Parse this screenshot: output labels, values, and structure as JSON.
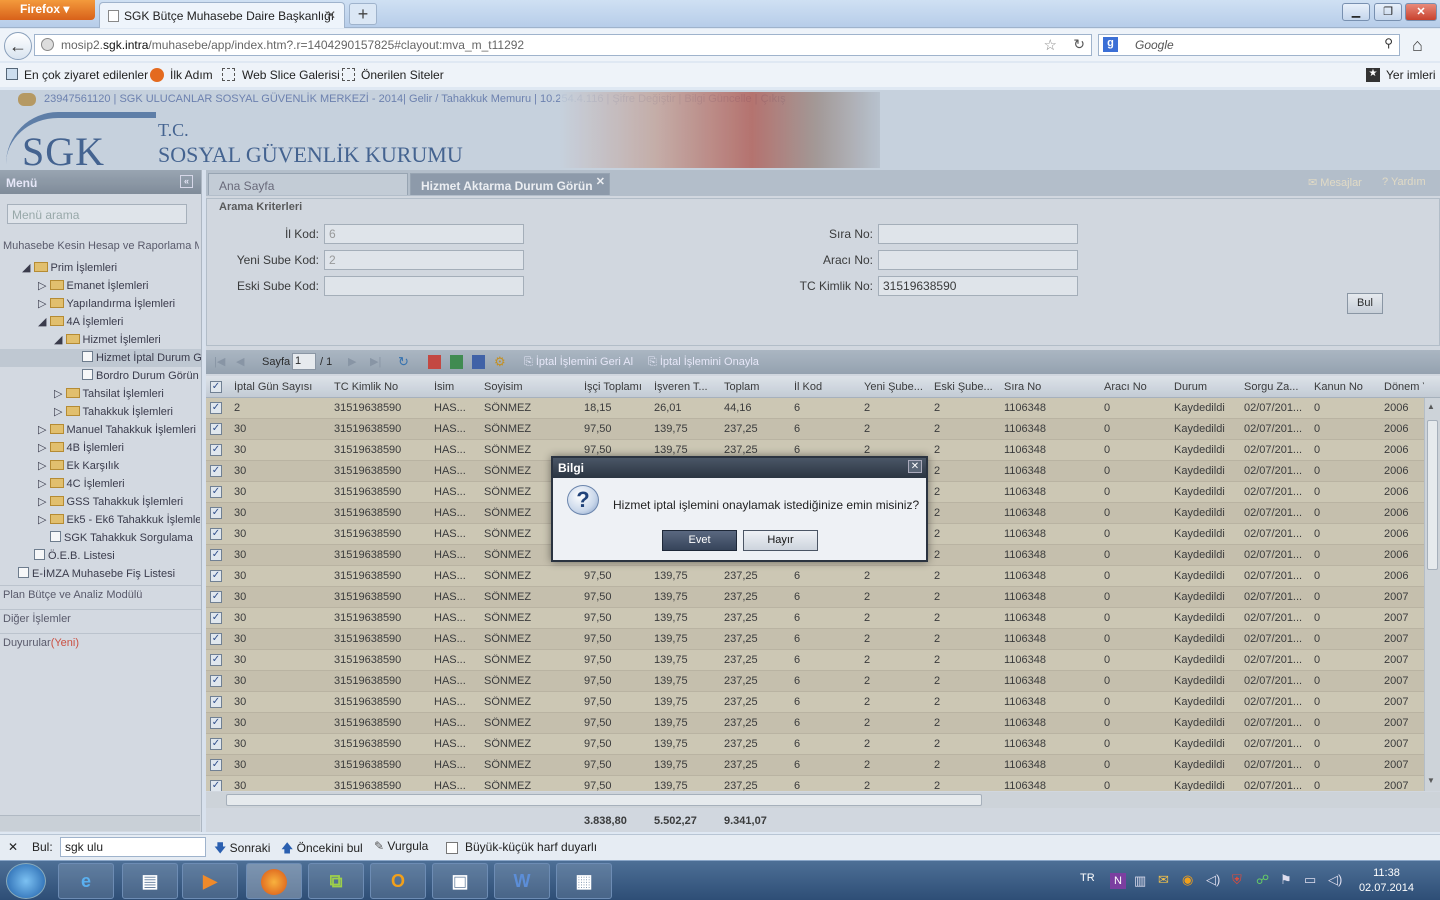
{
  "browser": {
    "app_button": "Firefox",
    "tab_title": "SGK Bütçe Muhasebe Daire Başkanlığı",
    "url_prefix": "mosip2.",
    "url_host": "sgk.intra",
    "url_rest": "/muhasebe/app/index.htm?.r=1404290157825#clayout:mva_m_t11292",
    "search_placeholder": "Google",
    "bookmarks": [
      "En çok ziyaret edilenler",
      "İlk Adım",
      "Web Slice Galerisi",
      "Önerilen Siteler"
    ],
    "bookmarks_right": "Yer imleri"
  },
  "app": {
    "status_line": "23947561120 | SGK ULUCANLAR SOSYAL GÜVENLİK MERKEZİ - 2014| Gelir / Tahakkuk Memuru | 10.254.4.116 | Şifre Değiştir | Bilgi Güncelle | Çıkış",
    "logo_text": "SGK",
    "org_line1": "T.C.",
    "org_line2": "SOSYAL GÜVENLİK KURUMU"
  },
  "sidebar": {
    "title": "Menü",
    "search_placeholder": "Menü arama",
    "section": "Muhasebe Kesin Hesap ve Raporlama Mo",
    "items": [
      "Prim İşlemleri",
      "Emanet İşlemleri",
      "Yapılandırma İşlemleri",
      "4A İşlemleri",
      "Hizmet İşlemleri",
      "Hizmet İptal Durum G",
      "Bordro Durum Görün",
      "Tahsilat İşlemleri",
      "Tahakkuk İşlemleri",
      "Manuel Tahakkuk İşlemleri",
      "4B İşlemleri",
      "Ek Karşılık",
      "4C İşlemleri",
      "GSS Tahakkuk İşlemleri",
      "Ek5 - Ek6 Tahakkuk İşlemleri",
      "SGK Tahakkuk Sorgulama",
      "Ö.E.B. Listesi",
      "E-İMZA Muhasebe Fiş Listesi"
    ],
    "bottom": [
      "Plan Bütçe ve Analiz Modülü",
      "Diğer İşlemler",
      "Duyurular"
    ],
    "new_label": "(Yeni)"
  },
  "tabs": {
    "home": "Ana Sayfa",
    "active": "Hizmet Aktarma Durum Görün",
    "messages": "Mesajlar",
    "help": "Yardım"
  },
  "criteria": {
    "title": "Arama Kriterleri",
    "il_kod_label": "İl Kod:",
    "il_kod_value": "6",
    "yeni_sube_label": "Yeni Sube Kod:",
    "yeni_sube_value": "2",
    "eski_sube_label": "Eski Sube Kod:",
    "eski_sube_value": "",
    "sira_label": "Sıra No:",
    "sira_value": "",
    "araci_label": "Aracı No:",
    "araci_value": "",
    "tc_label": "TC Kimlik No:",
    "tc_value": "31519638590",
    "search_button": "Bul"
  },
  "toolbar": {
    "page_label": "Sayfa",
    "page_value": "1",
    "page_total": "/ 1",
    "undo_cancel": "İptal İşlemini Geri Al",
    "approve_cancel": "İptal İşlemini Onayla"
  },
  "grid": {
    "headers": [
      "İptal Gün Sayısı",
      "TC Kimlik No",
      "İsim",
      "Soyisim",
      "İşçi Toplamı",
      "İşveren T...",
      "Toplam",
      "İl Kod",
      "Yeni Şube...",
      "Eski Şube...",
      "Sıra No",
      "Aracı No",
      "Durum",
      "Sorgu Za...",
      "Kanun No",
      "Dönem Yıl"
    ],
    "rows": [
      [
        "2",
        "31519638590",
        "HAS...",
        "SÖNMEZ",
        "18,15",
        "26,01",
        "44,16",
        "6",
        "2",
        "2",
        "1106348",
        "0",
        "Kaydedildi",
        "02/07/201...",
        "0",
        "2006"
      ],
      [
        "30",
        "31519638590",
        "HAS...",
        "SÖNMEZ",
        "97,50",
        "139,75",
        "237,25",
        "6",
        "2",
        "2",
        "1106348",
        "0",
        "Kaydedildi",
        "02/07/201...",
        "0",
        "2006"
      ],
      [
        "30",
        "31519638590",
        "HAS...",
        "SÖNMEZ",
        "97,50",
        "139,75",
        "237,25",
        "6",
        "2",
        "2",
        "1106348",
        "0",
        "Kaydedildi",
        "02/07/201...",
        "0",
        "2006"
      ],
      [
        "30",
        "31519638590",
        "HAS...",
        "SÖNMEZ",
        "97,50",
        "139,75",
        "237,25",
        "6",
        "2",
        "2",
        "1106348",
        "0",
        "Kaydedildi",
        "02/07/201...",
        "0",
        "2006"
      ],
      [
        "30",
        "31519638590",
        "HAS...",
        "SÖNMEZ",
        "97,50",
        "139,75",
        "237,25",
        "6",
        "2",
        "2",
        "1106348",
        "0",
        "Kaydedildi",
        "02/07/201...",
        "0",
        "2006"
      ],
      [
        "30",
        "31519638590",
        "HAS...",
        "SÖNMEZ",
        "97,50",
        "139,75",
        "237,25",
        "6",
        "2",
        "2",
        "1106348",
        "0",
        "Kaydedildi",
        "02/07/201...",
        "0",
        "2006"
      ],
      [
        "30",
        "31519638590",
        "HAS...",
        "SÖNMEZ",
        "97,50",
        "139,75",
        "237,25",
        "6",
        "2",
        "2",
        "1106348",
        "0",
        "Kaydedildi",
        "02/07/201...",
        "0",
        "2006"
      ],
      [
        "30",
        "31519638590",
        "HAS...",
        "SÖNMEZ",
        "97,50",
        "139,75",
        "237,25",
        "6",
        "2",
        "2",
        "1106348",
        "0",
        "Kaydedildi",
        "02/07/201...",
        "0",
        "2006"
      ],
      [
        "30",
        "31519638590",
        "HAS...",
        "SÖNMEZ",
        "97,50",
        "139,75",
        "237,25",
        "6",
        "2",
        "2",
        "1106348",
        "0",
        "Kaydedildi",
        "02/07/201...",
        "0",
        "2006"
      ],
      [
        "30",
        "31519638590",
        "HAS...",
        "SÖNMEZ",
        "97,50",
        "139,75",
        "237,25",
        "6",
        "2",
        "2",
        "1106348",
        "0",
        "Kaydedildi",
        "02/07/201...",
        "0",
        "2007"
      ],
      [
        "30",
        "31519638590",
        "HAS...",
        "SÖNMEZ",
        "97,50",
        "139,75",
        "237,25",
        "6",
        "2",
        "2",
        "1106348",
        "0",
        "Kaydedildi",
        "02/07/201...",
        "0",
        "2007"
      ],
      [
        "30",
        "31519638590",
        "HAS...",
        "SÖNMEZ",
        "97,50",
        "139,75",
        "237,25",
        "6",
        "2",
        "2",
        "1106348",
        "0",
        "Kaydedildi",
        "02/07/201...",
        "0",
        "2007"
      ],
      [
        "30",
        "31519638590",
        "HAS...",
        "SÖNMEZ",
        "97,50",
        "139,75",
        "237,25",
        "6",
        "2",
        "2",
        "1106348",
        "0",
        "Kaydedildi",
        "02/07/201...",
        "0",
        "2007"
      ],
      [
        "30",
        "31519638590",
        "HAS...",
        "SÖNMEZ",
        "97,50",
        "139,75",
        "237,25",
        "6",
        "2",
        "2",
        "1106348",
        "0",
        "Kaydedildi",
        "02/07/201...",
        "0",
        "2007"
      ],
      [
        "30",
        "31519638590",
        "HAS...",
        "SÖNMEZ",
        "97,50",
        "139,75",
        "237,25",
        "6",
        "2",
        "2",
        "1106348",
        "0",
        "Kaydedildi",
        "02/07/201...",
        "0",
        "2007"
      ],
      [
        "30",
        "31519638590",
        "HAS...",
        "SÖNMEZ",
        "97,50",
        "139,75",
        "237,25",
        "6",
        "2",
        "2",
        "1106348",
        "0",
        "Kaydedildi",
        "02/07/201...",
        "0",
        "2007"
      ],
      [
        "30",
        "31519638590",
        "HAS...",
        "SÖNMEZ",
        "97,50",
        "139,75",
        "237,25",
        "6",
        "2",
        "2",
        "1106348",
        "0",
        "Kaydedildi",
        "02/07/201...",
        "0",
        "2007"
      ],
      [
        "30",
        "31519638590",
        "HAS...",
        "SÖNMEZ",
        "97,50",
        "139,75",
        "237,25",
        "6",
        "2",
        "2",
        "1106348",
        "0",
        "Kaydedildi",
        "02/07/201...",
        "0",
        "2007"
      ],
      [
        "30",
        "31519638590",
        "HAS...",
        "SÖNMEZ",
        "97,50",
        "139,75",
        "237,25",
        "6",
        "2",
        "2",
        "1106348",
        "0",
        "Kaydedildi",
        "02/07/201...",
        "0",
        "2007"
      ]
    ],
    "totals": {
      "isci": "3.838,80",
      "isveren": "5.502,27",
      "toplam": "9.341,07"
    }
  },
  "dialog": {
    "title": "Bilgi",
    "message": "Hizmet iptal işlemini onaylamak istediğinize emin misiniz?",
    "yes": "Evet",
    "no": "Hayır",
    "icon": "question-icon"
  },
  "findbar": {
    "label": "Bul:",
    "value": "sgk ulu",
    "next": "Sonraki",
    "prev": "Öncekini bul",
    "highlight": "Vurgula",
    "case": "Büyük-küçük harf duyarlı"
  },
  "taskbar": {
    "lang": "TR",
    "time": "11:38",
    "date": "02.07.2014"
  }
}
